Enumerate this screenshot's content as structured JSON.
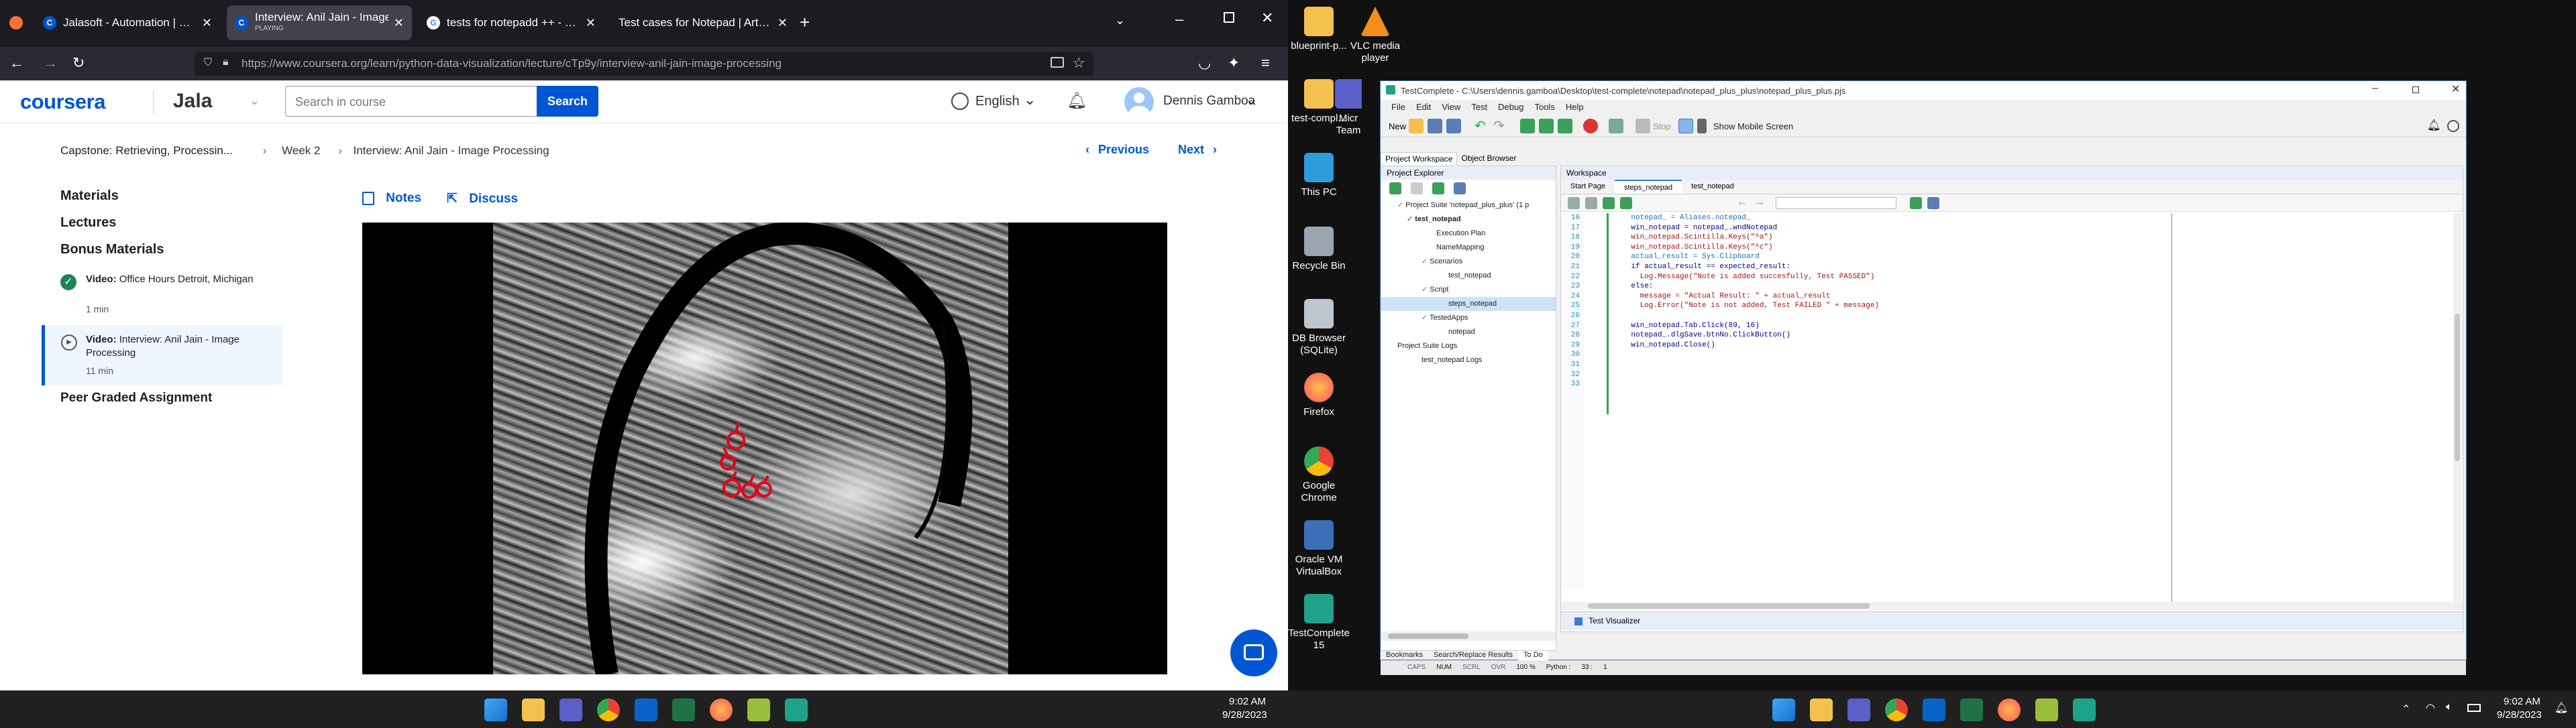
{
  "browser": {
    "tabs": [
      {
        "title": "Jalasoft - Automation | Coursera",
        "favicon": "C",
        "color": "#0056d2",
        "subtitle": ""
      },
      {
        "title": "Interview: Anil Jain - Image Pro",
        "favicon": "C",
        "color": "#0056d2",
        "subtitle": "PLAYING"
      },
      {
        "title": "tests for notepadd ++ - Buscar",
        "favicon": "G",
        "color": "#4285f4",
        "subtitle": ""
      },
      {
        "title": "Test cases for Notepad | ArtOfT",
        "favicon": "A",
        "color": "#777777",
        "subtitle": ""
      }
    ],
    "url": "https://www.coursera.org/learn/python-data-visualization/lecture/cTp9y/interview-anil-jain-image-processing"
  },
  "coursera": {
    "logo": "coursera",
    "partner": "Jala",
    "search_placeholder": "Search in course",
    "search_button": "Search",
    "language": "English",
    "user_name": "Dennis Gamboa",
    "breadcrumb": [
      "Capstone: Retrieving, Processin...",
      "Week 2",
      "Interview: Anil Jain - Image Processing"
    ],
    "previous": "Previous",
    "next": "Next",
    "sidebar": {
      "materials": "Materials",
      "lectures": "Lectures",
      "bonus": "Bonus Materials",
      "items": [
        {
          "kind": "Video:",
          "title": "Office Hours Detroit, Michigan",
          "duration": "1 min"
        },
        {
          "kind": "Video:",
          "title": "Interview: Anil Jain - Image Processing",
          "duration": "11 min"
        }
      ],
      "peer": "Peer Graded Assignment"
    },
    "notes": "Notes",
    "discuss": "Discuss"
  },
  "taskbar_left": {
    "time": "9:02 AM",
    "date": "9/28/2023"
  },
  "desktop": {
    "icons": [
      {
        "label": "blueprint-p...",
        "color": "#f2c14e"
      },
      {
        "label": "VLC media player",
        "color": "#f28c1c"
      },
      {
        "label": "test-compl...",
        "color": "#f2c14e"
      },
      {
        "label": "Micr Team",
        "color": "#5b5fc7"
      },
      {
        "label": "This PC",
        "color": "#2d9cdb"
      },
      {
        "label": "Recycle Bin",
        "color": "#9aa5b1"
      },
      {
        "label": "DB Browser (SQLite)",
        "color": "#bfc5cc"
      },
      {
        "label": "Firefox",
        "color": "#ff7139"
      },
      {
        "label": "Google Chrome",
        "color": "#34a853"
      },
      {
        "label": "Oracle VM VirtualBox",
        "color": "#3d6fb6"
      },
      {
        "label": "TestComplete 15",
        "color": "#1fa28a"
      }
    ]
  },
  "testcomplete": {
    "title": "TestComplete - C:\\Users\\dennis.gamboa\\Desktop\\test-complete\\notepad\\notepad_plus_plus\\notepad_plus_plus.pjs",
    "menu": [
      "File",
      "Edit",
      "View",
      "Test",
      "Debug",
      "Tools",
      "Help"
    ],
    "new_label": "New",
    "stop_label": "Stop",
    "mobile_label": "Show Mobile Screen",
    "panel_tabs": [
      "Project Workspace",
      "Object Browser"
    ],
    "project_explorer": "Project Explorer",
    "tree": [
      "Project Suite 'notepad_plus_plus' (1 p",
      "test_notepad",
      "Execution Plan",
      "NameMapping",
      "Scenarios",
      "test_notepad",
      "Script",
      "steps_notepad",
      "TestedApps",
      "notepad",
      "Project Suite Logs",
      "test_notepad Logs"
    ],
    "workspace": "Workspace",
    "editor_tabs": [
      "Start Page",
      "steps_notepad",
      "test_notepad"
    ],
    "line_numbers": [
      "16",
      "17",
      "18",
      "19",
      "20",
      "21",
      "22",
      "23",
      "24",
      "25",
      "26",
      "27",
      "28",
      "29",
      "30",
      "31",
      "32",
      "33"
    ],
    "code": [
      "    notepad_ = Aliases.notepad_",
      "    win_notepad = notepad_.wndNotepad",
      "    win_notepad.Scintilla.Keys(\"^a\")",
      "    win_notepad.Scintilla.Keys(\"^c\")",
      "    actual_result = Sys.Clipboard",
      "    if actual_result == expected_result:",
      "      Log.Message(\"Note is added succesfully, Test PASSED\")",
      "    else:",
      "      message = \"Actual Result: \" + actual_result",
      "      Log.Error(\"Note is not added, Test FAILED \" + message)",
      "",
      "    win_notepad.Tab.Click(89, 16)",
      "    notepad_.dlgSave.btnNo.ClickButton()",
      "    win_notepad.Close()",
      "",
      "",
      "",
      ""
    ],
    "bottom_tabs": [
      "Bookmarks",
      "Search/Replace Results",
      "To Do"
    ],
    "test_visualizer": "Test Visualizer",
    "status": [
      "CAPS",
      "NUM",
      "SCRL",
      "OVR",
      "100 %",
      "Python :",
      "33 :",
      "1"
    ]
  },
  "taskbar_right": {
    "time": "9:02 AM",
    "date": "9/28/2023"
  }
}
